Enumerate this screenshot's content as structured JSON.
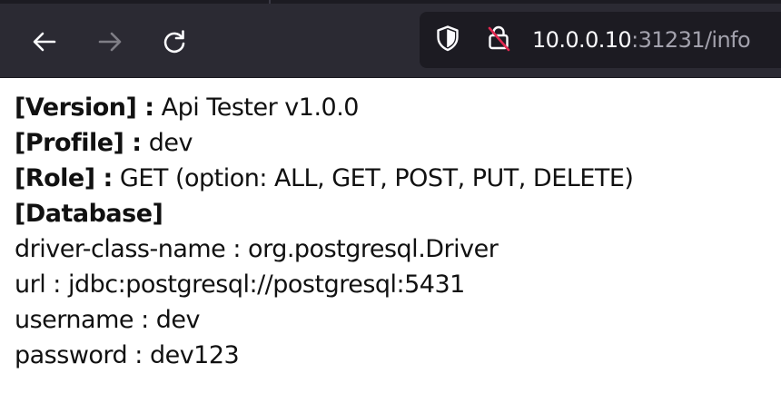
{
  "browser": {
    "address": {
      "host": "10.0.0.10",
      "path": ":31231/info"
    },
    "icons": {
      "back": "back-arrow-icon",
      "forward": "forward-arrow-icon",
      "reload": "reload-icon",
      "shield": "shield-icon",
      "insecure_lock": "insecure-lock-icon"
    }
  },
  "info": {
    "version_key": "[Version] :",
    "version_value": "Api Tester v1.0.0",
    "profile_key": "[Profile] :",
    "profile_value": "dev",
    "role_key": "[Role] :",
    "role_value": "GET (option: ALL, GET, POST, PUT, DELETE)",
    "database_key": "[Database]",
    "driver_line": "driver-class-name : org.postgresql.Driver",
    "url_line": "url : jdbc:postgresql://postgresql:5431",
    "username_line": "username : dev",
    "password_line": "password : dev123"
  }
}
